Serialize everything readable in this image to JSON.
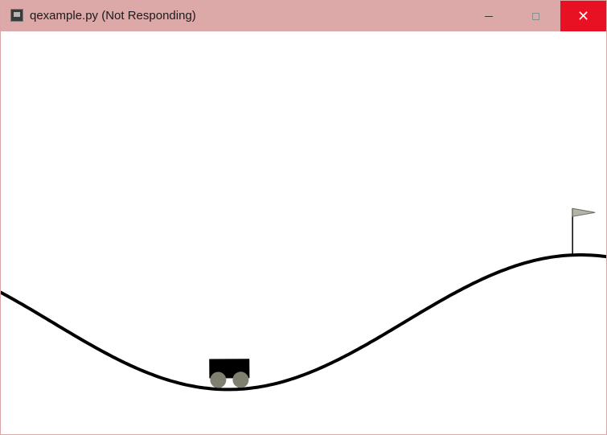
{
  "window": {
    "title": "qexample.py (Not Responding)",
    "icon": "python-window-icon",
    "controls": {
      "minimize": "minimize-icon",
      "maximize": "maximize-icon",
      "close": "close-icon"
    },
    "close_color": "#e81123",
    "titlebar_color": "#dca8a8"
  },
  "scene": {
    "environment": "MountainCar",
    "track_color": "#000000",
    "car_body_color": "#000000",
    "wheel_color": "#808070",
    "flag_color": "#b4b4a8",
    "car_position": -0.52,
    "goal_position": 0.5
  }
}
